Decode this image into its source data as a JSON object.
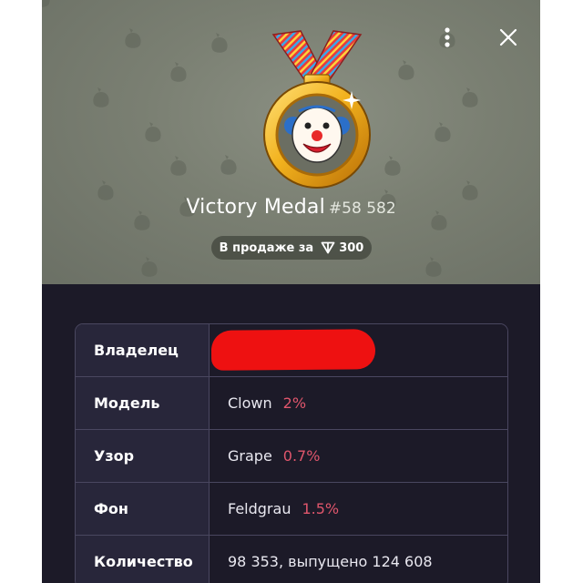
{
  "colors": {
    "header_bg": "#7a7f72",
    "panel_bg": "#1c1a28",
    "label_bg": "#28263a",
    "rarity": "#e0566c",
    "redaction": "#ee1111"
  },
  "gift": {
    "name": "Victory Medal",
    "number": "#58 582",
    "sale_label": "В продаже за",
    "price": "300",
    "currency_icon": "ton-icon"
  },
  "header_actions": {
    "menu_icon": "more-vertical-icon",
    "close_icon": "close-icon"
  },
  "details": [
    {
      "label": "Владелец",
      "value": "",
      "rarity": "",
      "redacted": true
    },
    {
      "label": "Модель",
      "value": "Clown",
      "rarity": "2%"
    },
    {
      "label": "Узор",
      "value": "Grape",
      "rarity": "0.7%"
    },
    {
      "label": "Фон",
      "value": "Feldgrau",
      "rarity": "1.5%"
    },
    {
      "label": "Количество",
      "value": "98 353, выпущено 124 608",
      "rarity": ""
    }
  ]
}
